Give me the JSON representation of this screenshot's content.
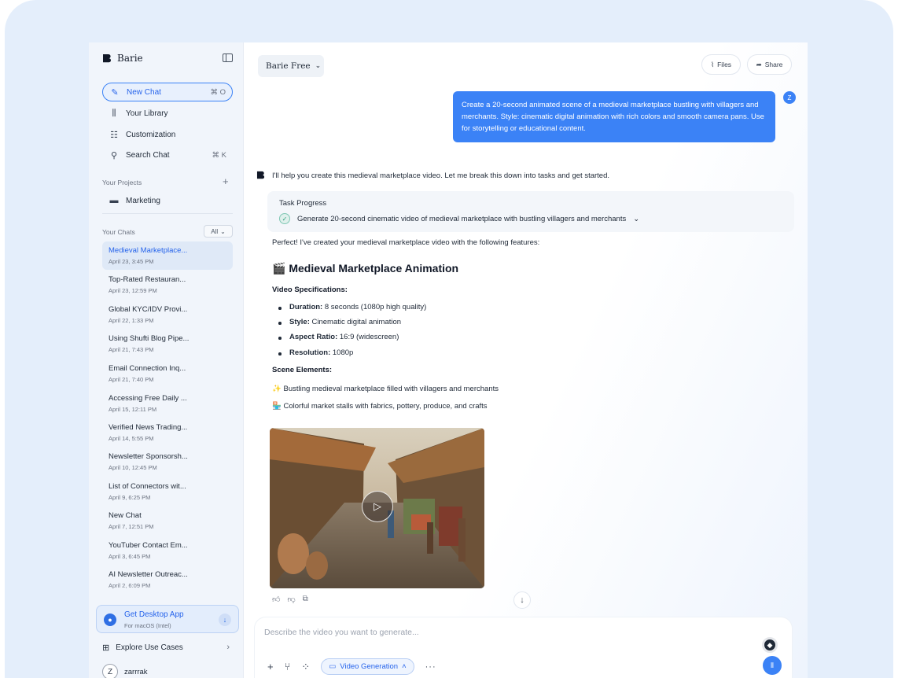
{
  "brand": {
    "name": "Barie"
  },
  "nav": {
    "new_chat": {
      "label": "New Chat",
      "shortcut": "⌘ O"
    },
    "library": {
      "label": "Your Library"
    },
    "customization": {
      "label": "Customization"
    },
    "search": {
      "label": "Search Chat",
      "shortcut": "⌘ K"
    }
  },
  "projects": {
    "header": "Your Projects",
    "items": [
      {
        "label": "Marketing"
      }
    ]
  },
  "chats": {
    "header": "Your Chats",
    "filter": "All",
    "items": [
      {
        "title": "Medieval Marketplace...",
        "date": "April 23, 3:45 PM"
      },
      {
        "title": "Top-Rated Restauran...",
        "date": "April 23, 12:59 PM"
      },
      {
        "title": "Global KYC/IDV Provi...",
        "date": "April 22, 1:33 PM"
      },
      {
        "title": "Using Shufti Blog Pipe...",
        "date": "April 21, 7:43 PM"
      },
      {
        "title": "Email Connection Inq...",
        "date": "April 21, 7:40 PM"
      },
      {
        "title": "Accessing Free Daily ...",
        "date": "April 15, 12:11 PM"
      },
      {
        "title": "Verified News Trading...",
        "date": "April 14, 5:55 PM"
      },
      {
        "title": "Newsletter Sponsorsh...",
        "date": "April 10, 12:45 PM"
      },
      {
        "title": "List of Connectors wit...",
        "date": "April 9, 6:25 PM"
      },
      {
        "title": "New Chat",
        "date": "April 7, 12:51 PM"
      },
      {
        "title": "YouTuber Contact Em...",
        "date": "April 3, 6:45 PM"
      },
      {
        "title": "AI Newsletter Outreac...",
        "date": "April 2, 6:09 PM"
      }
    ]
  },
  "desktop_app": {
    "title": "Get Desktop App",
    "subtitle": "For macOS (Intel)"
  },
  "explore": {
    "label": "Explore Use Cases"
  },
  "user": {
    "initial": "Z",
    "name": "zarrrak"
  },
  "header": {
    "model": "Barie Free",
    "files": "Files",
    "share": "Share"
  },
  "user_message": {
    "avatar": "Z",
    "text": "Create a 20-second animated scene of a medieval marketplace bustling with villagers and merchants. Style: cinematic digital animation with rich colors and smooth camera pans. Use for storytelling or educational content."
  },
  "response": {
    "intro": "I'll help you create this medieval marketplace video. Let me break this down into tasks and get started.",
    "task_label": "Task Progress",
    "task_item": "Generate 20-second cinematic video of medieval marketplace with bustling villagers and merchants",
    "perfect": "Perfect! I've created your medieval marketplace video with the following features:",
    "heading_icon": "🎬",
    "heading": "Medieval Marketplace Animation",
    "specs_heading": "Video Specifications:",
    "specs": [
      {
        "label": "Duration:",
        "value": "8 seconds (1080p high quality)"
      },
      {
        "label": "Style:",
        "value": "Cinematic digital animation"
      },
      {
        "label": "Aspect Ratio:",
        "value": "16:9 (widescreen)"
      },
      {
        "label": "Resolution:",
        "value": "1080p"
      }
    ],
    "scene_heading": "Scene Elements:",
    "scene": [
      {
        "icon": "✨",
        "text": "Bustling medieval marketplace filled with villagers and merchants"
      },
      {
        "icon": "🏪",
        "text": "Colorful market stalls with fabrics, pottery, produce, and crafts"
      }
    ]
  },
  "composer": {
    "placeholder": "Describe the video you want to generate...",
    "mode": "Video Generation"
  },
  "colors": {
    "accent": "#3b82f6",
    "sidebar_bg": "#f1f5fb",
    "frame_bg": "#e4eefb"
  }
}
